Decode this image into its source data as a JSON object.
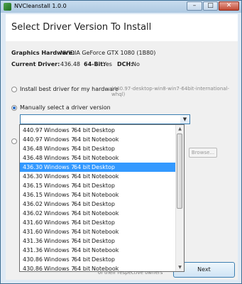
{
  "window": {
    "title": "NVCleanstall 1.0.0",
    "minimize": "–",
    "maximize": "□",
    "close": "✕"
  },
  "header": {
    "title": "Select Driver Version To Install"
  },
  "info": {
    "graphics_label": "Graphics Hardware:",
    "graphics_value": "NVIDIA GeForce GTX 1080 (1B80)",
    "current_label": "Current Driver:",
    "current_value": "436.48",
    "bit_label": "64-Bit:",
    "bit_value": "Yes",
    "dch_label": "DCH:",
    "dch_value": "No"
  },
  "options": {
    "best_label": "Install best driver for my hardware",
    "best_hint": "(440.97-desktop-win8-win7-64bit-international-whql)",
    "manual_label": "Manually select a driver version",
    "manual_selected": true,
    "combo_value": ""
  },
  "browse_label": "Browse...",
  "footer_note": "of their respective owners",
  "next_label": "Next",
  "driver_list": [
    {
      "version": "440.97",
      "os": "Windows 7",
      "bits": "64 bit",
      "type": "Desktop"
    },
    {
      "version": "440.97",
      "os": "Windows 7",
      "bits": "64 bit",
      "type": "Notebook"
    },
    {
      "version": "436.48",
      "os": "Windows 7",
      "bits": "64 bit",
      "type": "Desktop"
    },
    {
      "version": "436.48",
      "os": "Windows 7",
      "bits": "64 bit",
      "type": "Notebook"
    },
    {
      "version": "436.30",
      "os": "Windows 7",
      "bits": "64 bit",
      "type": "Desktop",
      "selected": true
    },
    {
      "version": "436.30",
      "os": "Windows 7",
      "bits": "64 bit",
      "type": "Notebook"
    },
    {
      "version": "436.15",
      "os": "Windows 7",
      "bits": "64 bit",
      "type": "Desktop"
    },
    {
      "version": "436.15",
      "os": "Windows 7",
      "bits": "64 bit",
      "type": "Notebook"
    },
    {
      "version": "436.02",
      "os": "Windows 7",
      "bits": "64 bit",
      "type": "Desktop"
    },
    {
      "version": "436.02",
      "os": "Windows 7",
      "bits": "64 bit",
      "type": "Notebook"
    },
    {
      "version": "431.60",
      "os": "Windows 7",
      "bits": "64 bit",
      "type": "Desktop"
    },
    {
      "version": "431.60",
      "os": "Windows 7",
      "bits": "64 bit",
      "type": "Notebook"
    },
    {
      "version": "431.36",
      "os": "Windows 7",
      "bits": "64 bit",
      "type": "Desktop"
    },
    {
      "version": "431.36",
      "os": "Windows 7",
      "bits": "64 bit",
      "type": "Notebook"
    },
    {
      "version": "430.86",
      "os": "Windows 7",
      "bits": "64 bit",
      "type": "Desktop"
    },
    {
      "version": "430.86",
      "os": "Windows 7",
      "bits": "64 bit",
      "type": "Notebook"
    }
  ],
  "scroll": {
    "up": "▲",
    "down": "▼"
  }
}
